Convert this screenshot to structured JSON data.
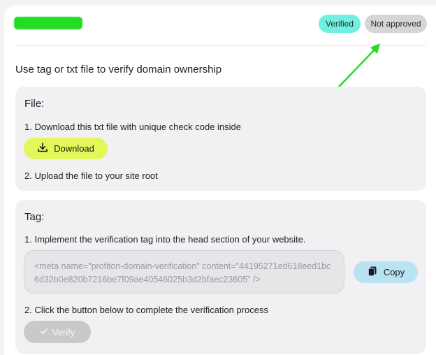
{
  "header": {
    "status_badges": [
      "Verified",
      "Not approved"
    ]
  },
  "main": {
    "heading": "Use tag or txt file to verify domain ownership",
    "file_section": {
      "title": "File:",
      "step1": "1. Download this txt file with unique check code inside",
      "download_label": "Download",
      "step2": "2. Upload the file to your site root"
    },
    "tag_section": {
      "title": "Tag:",
      "step1": "1. Implement the verification tag into the head section of your website.",
      "meta_tag": "<meta name=\"profiton-domain-verification\" content=\"44195271ed618eed1bc6d32b0e820b7216be7f09ae40546025b3d2bfaec23605\" />",
      "copy_label": "Copy",
      "step2": "2. Click the button below to complete the verification process",
      "verify_label": "Verify"
    }
  },
  "icons": {
    "download": "download-icon",
    "copy": "copy-icon",
    "check": "check-icon"
  },
  "colors": {
    "verified_badge": "#6ff0e0",
    "not_approved_badge": "#d6d6d8",
    "download_button": "#e3f75a",
    "copy_button": "#b9e3f3",
    "verify_button_disabled": "#c9c9cc",
    "annotation_arrow": "#22dd22",
    "redaction": "#22dd22"
  }
}
